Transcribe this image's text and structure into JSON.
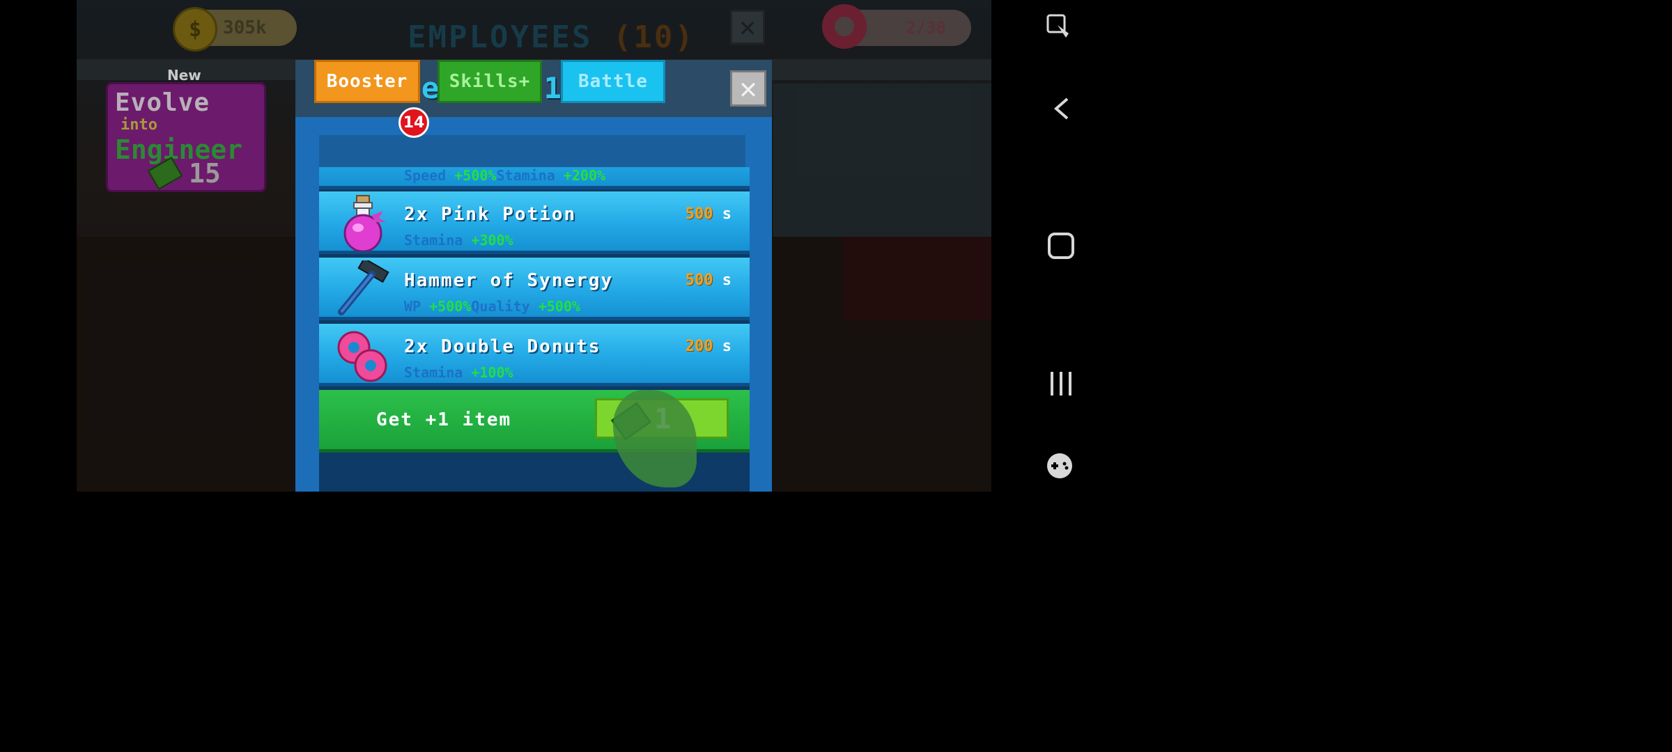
{
  "hud": {
    "money": "305k",
    "money_icon": "$",
    "employees_title": "EMPLOYEES",
    "employees_count": "(10)",
    "donuts": "2/38"
  },
  "evolve": {
    "new_label": "New",
    "line1": "Evolve",
    "line2": "into",
    "line3": "Engineer",
    "cost": "15"
  },
  "modal": {
    "title": "Select 1 item",
    "close_glyph": "✕",
    "tabs": [
      {
        "label": "Booster"
      },
      {
        "label": "Skills+"
      },
      {
        "label": "Battle"
      }
    ],
    "booster_badge": "14"
  },
  "items": [
    {
      "name": "",
      "stat1_label": "Speed",
      "stat1_value": "+500%",
      "stat2_label": "Stamina",
      "stat2_value": "+200%",
      "icon": "unknown-icon"
    },
    {
      "name": "2x Pink Potion",
      "stat1_label": "Stamina",
      "stat1_value": "+300%",
      "time_value": "500",
      "time_unit": "s",
      "icon": "pink-potion-icon"
    },
    {
      "name": "Hammer of Synergy",
      "stat1_label": "WP",
      "stat1_value": "+500%",
      "stat2_label": "Quality",
      "stat2_value": "+500%",
      "time_value": "500",
      "time_unit": "s",
      "icon": "hammer-icon"
    },
    {
      "name": "2x Double Donuts",
      "stat1_label": "Stamina",
      "stat1_value": "+100%",
      "time_value": "200",
      "time_unit": "s",
      "icon": "donut-icon"
    }
  ],
  "get_item": {
    "label": "Get +1 item",
    "price": "1",
    "price_icon": "cash-icon"
  },
  "colors": {
    "accent_title": "#33c6ec",
    "stat_value": "#21e041",
    "time_value": "#f0a020",
    "booster_tab": "#f2961e",
    "skills_tab": "#2fa628",
    "battle_tab": "#1ac2f0"
  }
}
